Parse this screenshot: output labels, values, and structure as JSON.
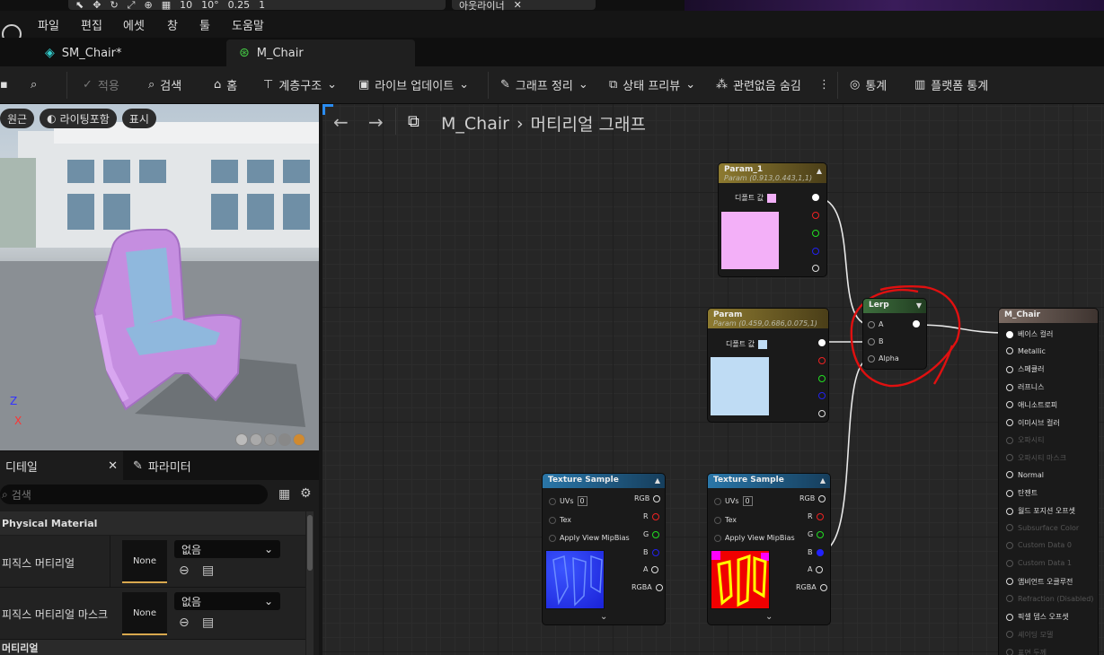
{
  "top_strip": {
    "snap_grid": "10",
    "rotate_snap": "10°",
    "scale_snap": "0.25",
    "camera_speed": "1",
    "outliner_tab": "아웃라이너"
  },
  "menu": [
    "파일",
    "편집",
    "에셋",
    "창",
    "툴",
    "도움말"
  ],
  "tabs": [
    {
      "label": "SM_Chair*"
    },
    {
      "label": "M_Chair"
    }
  ],
  "toolbar": {
    "apply": "적용",
    "search": "검색",
    "home": "홈",
    "hierarchy": "계층구조",
    "live_update": "라이브 업데이트",
    "graph_cleanup": "그래프 정리",
    "preview_state": "상태 프리뷰",
    "hide_unrelated": "관련없음 숨김",
    "stats": "통계",
    "platform_stats": "플랫폼 통계"
  },
  "viewport": {
    "pills": [
      "원근",
      "라이팅포함",
      "표시"
    ],
    "axis_z": "Z",
    "axis_x": "X"
  },
  "details": {
    "tab_details": "디테일",
    "tab_params": "파라미터",
    "search_placeholder": "검색",
    "section_physical": "Physical Material",
    "row1_label": "피직스 머티리얼",
    "row2_label": "피직스 머티리얼 마스크",
    "none": "None",
    "dropdown_value": "없음",
    "section_material": "머티리얼"
  },
  "graph": {
    "breadcrumb_asset": "M_Chair",
    "breadcrumb_graph": "머티리얼 그래프"
  },
  "nodes": {
    "param1": {
      "title": "Param_1",
      "sub": "Param (0.913,0.443,1,1)",
      "default": "디폴트 값",
      "swatch": "#f3b0f8",
      "header_color": "#6e5c22"
    },
    "param": {
      "title": "Param",
      "sub": "Param (0.459,0.686,0.075,1)",
      "default": "디폴트 값",
      "swatch": "#bfdcf4",
      "header_color": "#6e5c22"
    },
    "lerp": {
      "title": "Lerp",
      "a": "A",
      "b": "B",
      "alpha": "Alpha",
      "header_color": "#2e5a2e"
    },
    "tex1": {
      "title": "Texture Sample",
      "uvs": "UVs",
      "uv_val": "0",
      "tex": "Tex",
      "mip": "Apply View MipBias",
      "rgb": "RGB",
      "r": "R",
      "g": "G",
      "b": "B",
      "a": "A",
      "rgba": "RGBA",
      "header_color": "#1d5a86"
    },
    "tex2": {
      "title": "Texture Sample",
      "uvs": "UVs",
      "uv_val": "0",
      "tex": "Tex",
      "mip": "Apply View MipBias",
      "rgb": "RGB",
      "r": "R",
      "g": "G",
      "b": "B",
      "a": "A",
      "rgba": "RGBA",
      "header_color": "#1d5a86"
    },
    "mchair": {
      "title": "M_Chair",
      "header_color": "#5a4a44",
      "pins": [
        "베이스 컬러",
        "Metallic",
        "스페큘러",
        "러프니스",
        "애니소트로피",
        "이미시브 컬러",
        "오파시티",
        "오파시티 마스크",
        "Normal",
        "탄젠트",
        "월드 포지션 오프셋",
        "Subsurface Color",
        "Custom Data 0",
        "Custom Data 1",
        "앰비언트 오클루전",
        "Refraction (Disabled)",
        "픽셀 뎁스 오프셋",
        "셰이딩 모델",
        "표면 두께"
      ]
    }
  },
  "colors": {
    "annotation": "#e01010"
  }
}
